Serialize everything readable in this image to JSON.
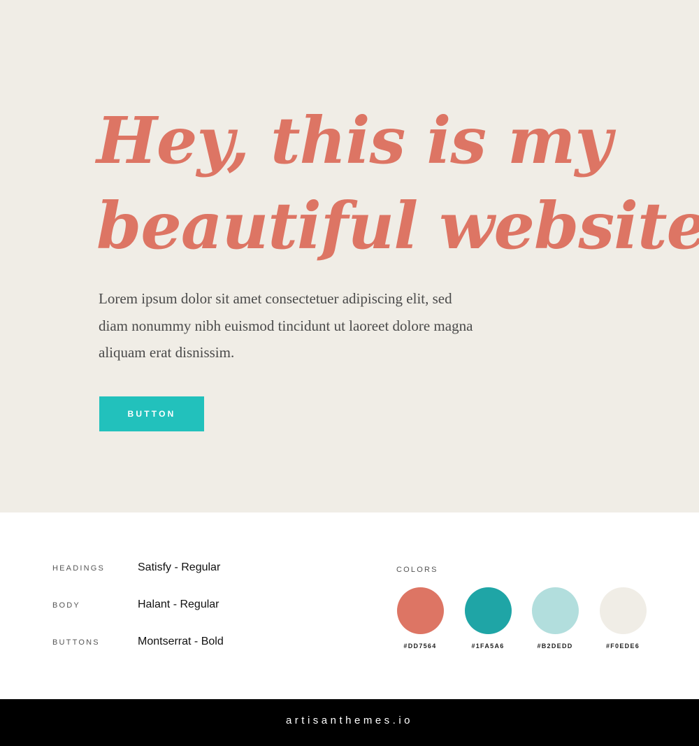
{
  "hero": {
    "headline_line1": "Hey, this is my",
    "headline_line2_prefix": "beautiful",
    "headline_highlight": "website",
    "body": "Lorem ipsum dolor sit amet consectetuer adipiscing elit, sed diam nonummy nibh euismod tincidunt ut laoreet dolore magna aliquam erat disnissim.",
    "button_label": "BUTTON"
  },
  "typography": [
    {
      "label": "HEADINGS",
      "value": "Satisfy - Regular"
    },
    {
      "label": "BODY",
      "value": "Halant - Regular"
    },
    {
      "label": "BUTTONS",
      "value": "Montserrat - Bold"
    }
  ],
  "colors": {
    "title": "COLORS",
    "swatches": [
      {
        "hex": "#DD7564",
        "color": "#DD7564"
      },
      {
        "hex": "#1FA5A6",
        "color": "#1FA5A6"
      },
      {
        "hex": "#B2DEDD",
        "color": "#B2DEDD"
      },
      {
        "hex": "#F0EDE6",
        "color": "#F0EDE6"
      }
    ]
  },
  "footer": {
    "brand": "artisanthemes.io"
  }
}
